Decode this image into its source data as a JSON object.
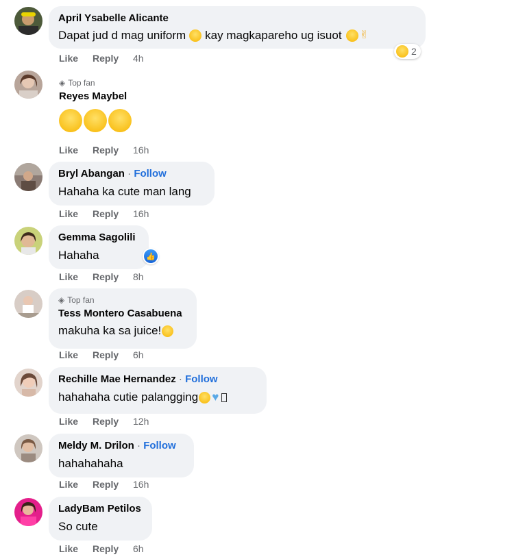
{
  "actions": {
    "like": "Like",
    "reply": "Reply"
  },
  "top_fan_label": "Top fan",
  "follow_label": "Follow",
  "comments": [
    {
      "name": "April Ysabelle Alicante",
      "text_a": "Dapat jud d mag uniform",
      "text_b": "kay magkapareho ug isuot",
      "time": "4h",
      "reaction_count": "2"
    },
    {
      "name": "Reyes Maybel",
      "time": "16h"
    },
    {
      "name": "Bryl Abangan",
      "text": "Hahaha ka cute man lang",
      "time": "16h"
    },
    {
      "name": "Gemma Sagolili",
      "text": "Hahaha",
      "time": "8h"
    },
    {
      "name": "Tess Montero Casabuena",
      "text": "makuha ka sa juice!",
      "time": "6h"
    },
    {
      "name": "Rechille Mae Hernandez",
      "text": "hahahaha cutie palangging",
      "time": "12h"
    },
    {
      "name": "Meldy M. Drilon",
      "text": "hahahahaha",
      "time": "16h"
    },
    {
      "name": "LadyBam Petilos",
      "text": "So cute",
      "time": "6h"
    }
  ],
  "colors": {
    "bubble": "#f0f2f5",
    "follow": "#216fdb",
    "meta": "#65676b"
  }
}
